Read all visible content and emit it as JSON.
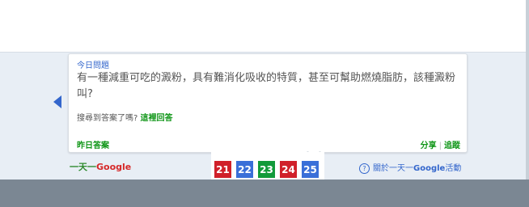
{
  "panel": {
    "today_label": "今日問題",
    "question": "有一種減重可吃的澱粉，具有難消化吸收的特質，甚至可幫助燃燒脂肪，該種澱粉叫?",
    "hint_text": "搜尋到答案了嗎?",
    "hint_link": "這裡回答",
    "yesterday_label": "昨日答案",
    "share_label": "分享",
    "follow_label": "追蹤"
  },
  "footer": {
    "brand_prefix": "一天一",
    "brand_google": "Google",
    "about_text": "關於一天一",
    "about_google": "Google",
    "about_suffix": "活動"
  },
  "days": [
    {
      "label": "21",
      "color": "#d0202a"
    },
    {
      "label": "22",
      "color": "#3a6fd8"
    },
    {
      "label": "23",
      "color": "#129a3a"
    },
    {
      "label": "24",
      "color": "#d0202a"
    },
    {
      "label": "25",
      "color": "#3a6fd8"
    }
  ],
  "colors": {
    "accent_blue": "#3366cc",
    "green": "#109618",
    "band": "#e8eef5"
  },
  "icons": {
    "prev": "left-arrow-icon",
    "help": "question-circle-icon"
  }
}
